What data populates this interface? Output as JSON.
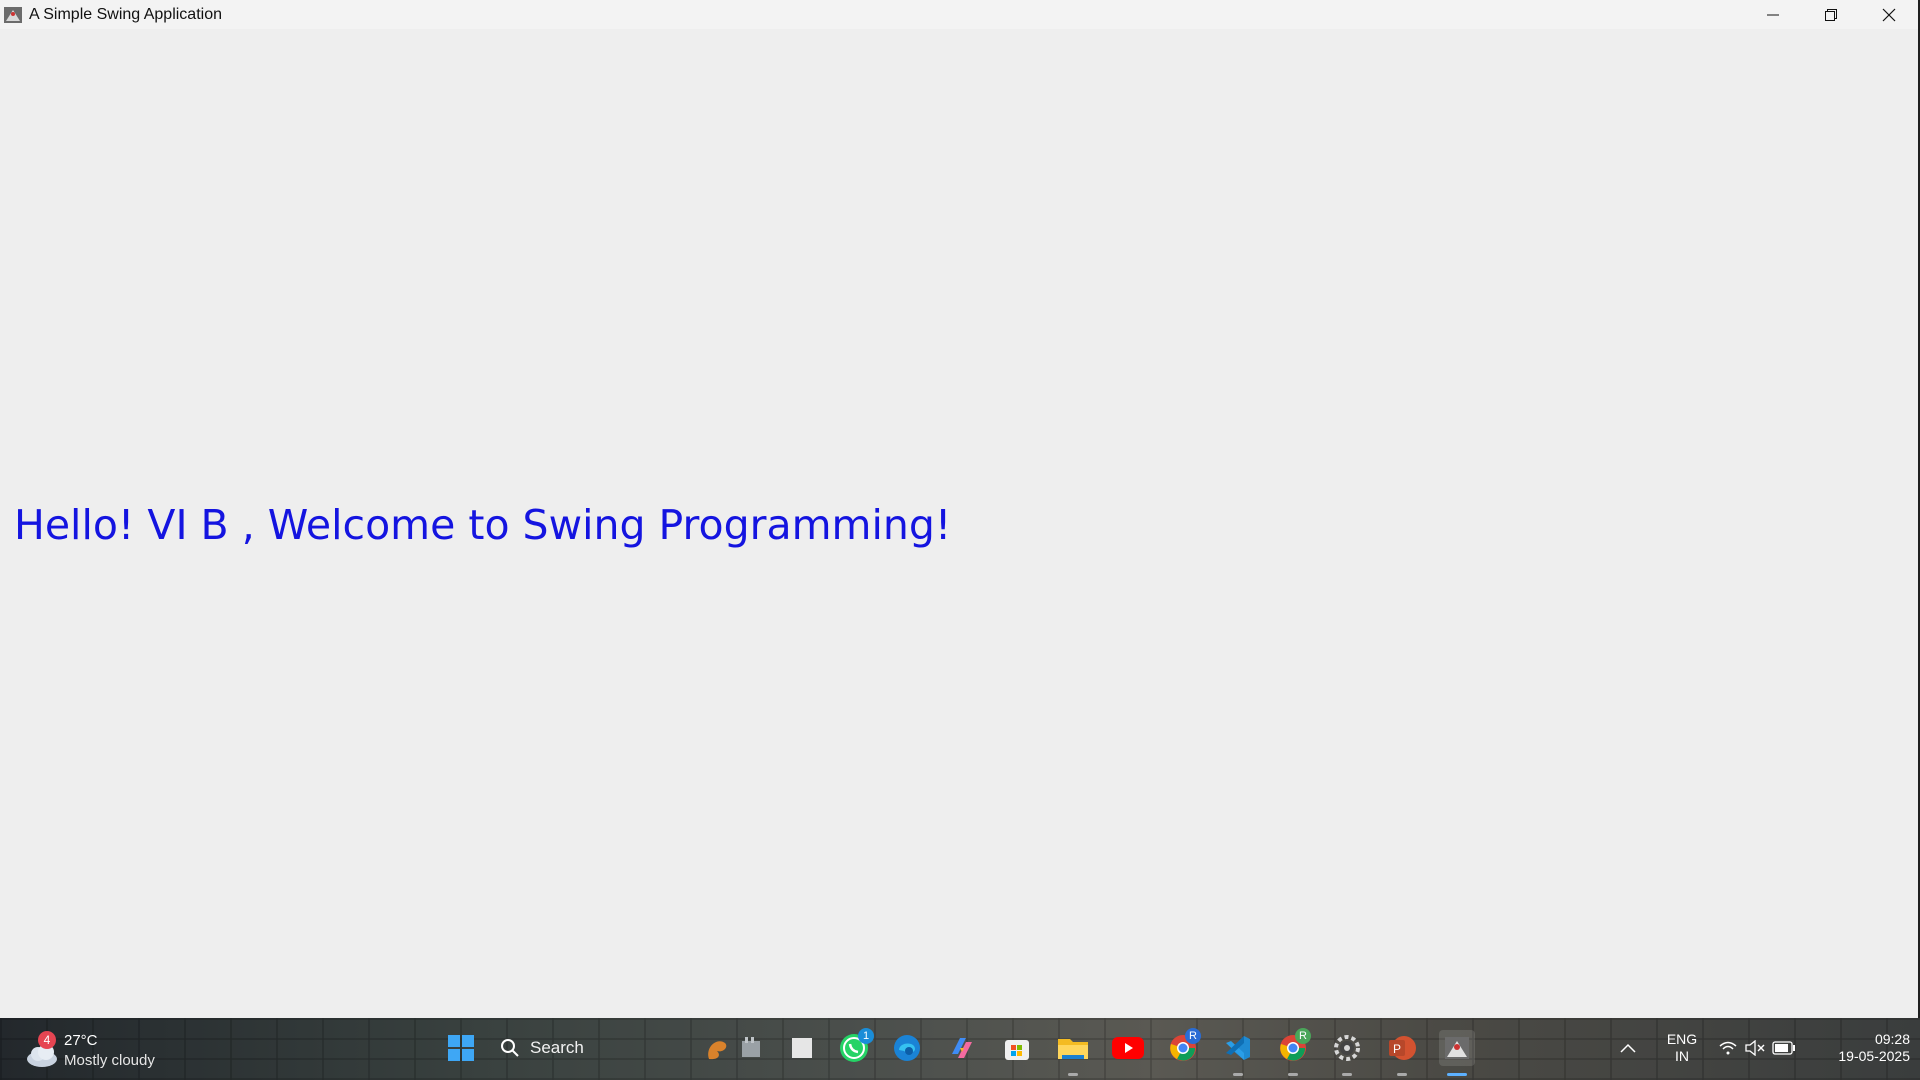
{
  "window": {
    "title": "A Simple Swing Application",
    "controls": [
      "minimize",
      "restore",
      "close"
    ]
  },
  "content": {
    "label": "Hello! VI B , Welcome to Swing Programming!",
    "label_color": "#1414e0"
  },
  "taskbar": {
    "weather": {
      "badge": "4",
      "temperature": "27°C",
      "condition": "Mostly cloudy"
    },
    "search_label": "Search",
    "whatsapp_badge": "1",
    "chrome_profile_badge": "R",
    "chrome2_profile_badge": "R",
    "tray": {
      "lang_primary": "ENG",
      "lang_secondary": "IN"
    },
    "clock": {
      "time": "09:28",
      "date": "19-05-2025"
    },
    "icons": [
      "windows-start-icon",
      "search-icon",
      "squirrel-app-icon",
      "widgets-app-icon",
      "file-app-icon",
      "whatsapp-icon",
      "edge-icon",
      "copilot-icon",
      "store-icon",
      "file-explorer-icon",
      "youtube-icon",
      "chrome-icon",
      "vscode-icon",
      "chrome-profile-icon",
      "settings-gear-icon",
      "powerpoint-icon",
      "java-app-icon"
    ]
  }
}
